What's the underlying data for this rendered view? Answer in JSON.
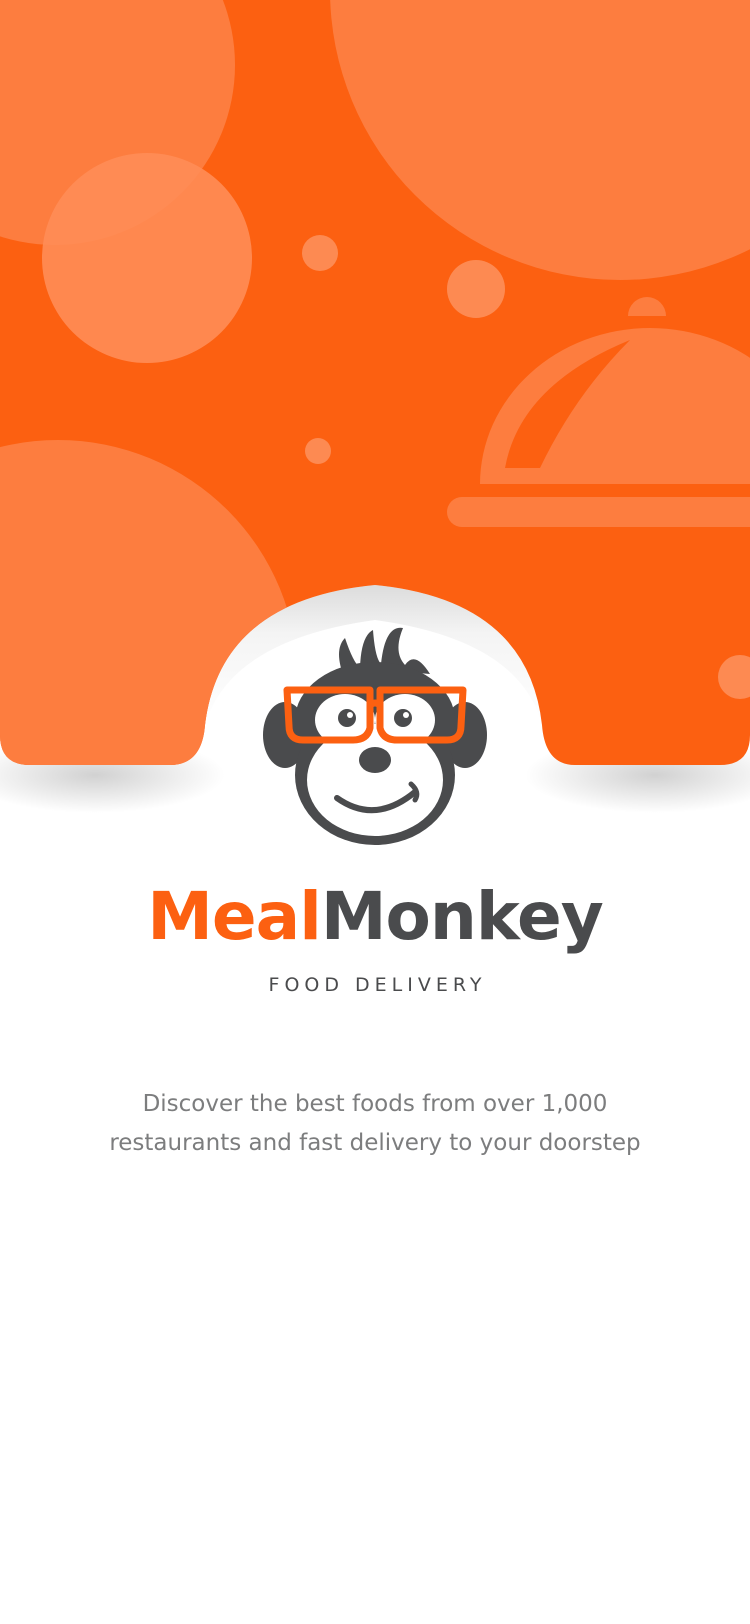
{
  "app": {
    "brand_part1": "Meal",
    "brand_part2": "Monkey",
    "tagline": "FOOD DELIVERY",
    "description_line1": "Discover the best foods from over 1,000",
    "description_line2": "restaurants and fast delivery to your doorstep"
  },
  "colors": {
    "accent": "#fc6011",
    "primary_text": "#4a4b4d",
    "secondary_text": "#7c7d7e",
    "background": "#ffffff"
  },
  "icons": {
    "logo": "monkey-with-glasses-icon",
    "decoration": "serving-cloche-icon"
  }
}
